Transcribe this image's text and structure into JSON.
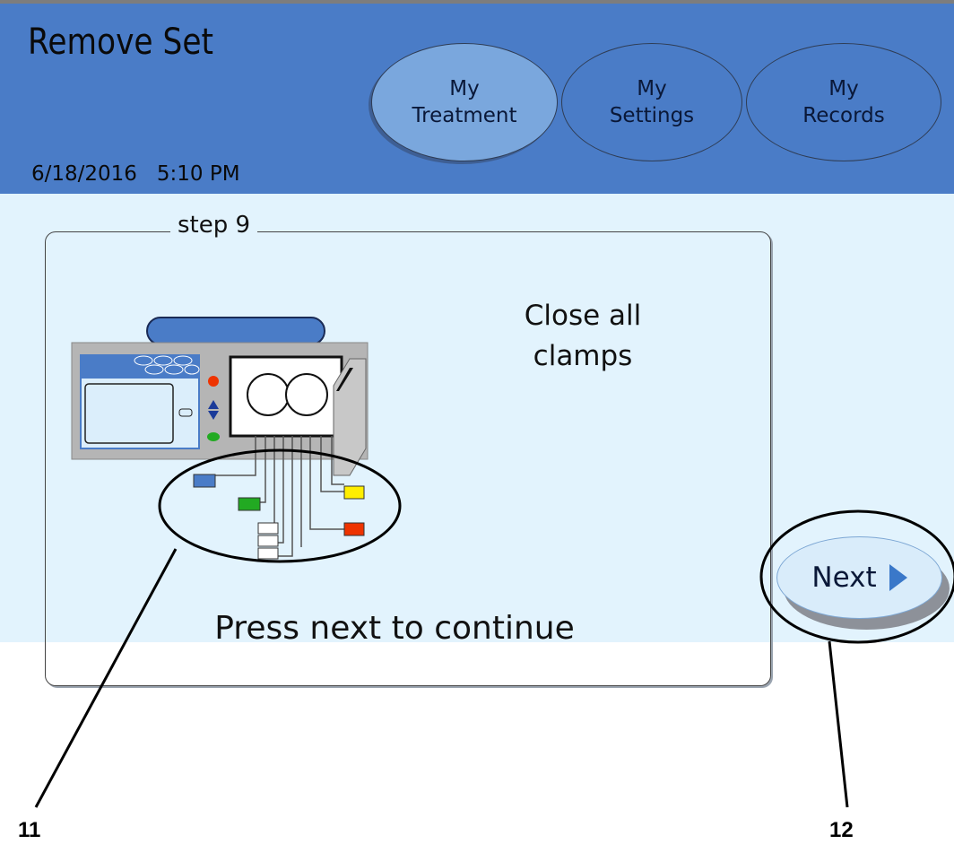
{
  "header": {
    "title": "Remove Set",
    "date": "6/18/2016",
    "time": "5:10 PM",
    "tabs": [
      {
        "line1": "My",
        "line2": "Treatment",
        "active": true
      },
      {
        "line1": "My",
        "line2": "Settings",
        "active": false
      },
      {
        "line1": "My",
        "line2": "Records",
        "active": false
      }
    ]
  },
  "panel": {
    "step_label": "step 9",
    "instruction_line1": "Close all",
    "instruction_line2": "clamps",
    "prompt": "Press next to continue"
  },
  "next_button": {
    "label": "Next"
  },
  "callouts": {
    "left": "11",
    "right": "12"
  },
  "colors": {
    "header_bg": "#4a7cc7",
    "content_bg": "#e2f3fd",
    "active_tab": "#7aa7dd",
    "clamp_blue": "#4a7cc7",
    "clamp_green": "#22aa22",
    "clamp_yellow": "#ffee00",
    "clamp_red": "#ee3300"
  }
}
